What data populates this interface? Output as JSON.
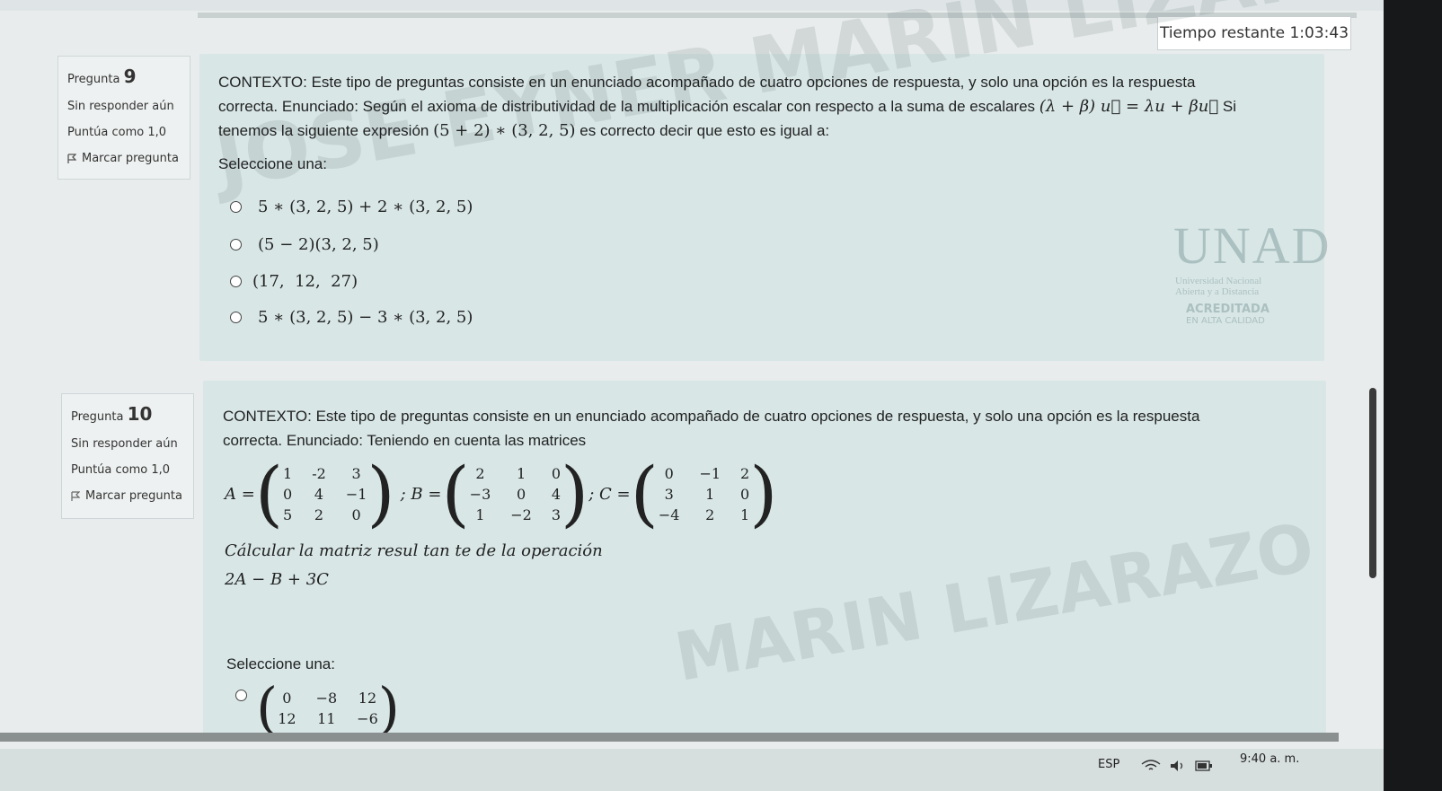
{
  "timer": {
    "label": "Tiempo restante",
    "value": "1:03:43"
  },
  "watermark": {
    "line1": "JOSE EYNER MARIN LIZARAZO",
    "line2": "MARIN LIZARAZO"
  },
  "logo": {
    "name": "UNAD",
    "sub1": "Universidad Nacional",
    "sub2": "Abierta y a Distancia",
    "badge": "ACREDITADA",
    "badge2": "EN ALTA CALIDAD"
  },
  "q9": {
    "label": "Pregunta",
    "number": "9",
    "status": "Sin responder aún",
    "score": "Puntúa como 1,0",
    "flag": "Marcar pregunta",
    "text1": "CONTEXTO: Este tipo de preguntas consiste en un enunciado acompañado de cuatro opciones de respuesta, y solo una opción es la respuesta",
    "text2a": "correcta. Enunciado: Según el axioma de distributividad de la multiplicación escalar con respecto a la suma de escalares",
    "formula1": "(λ + β) u⃗ = λu + βu⃗",
    "text2b": "Si",
    "text3a": "tenemos la siguiente expresión",
    "formula2": "(5 + 2) ∗ (3, 2, 5)",
    "text3b": "es correcto decir que esto es igual a:",
    "prompt": "Seleccione una:",
    "options": [
      "5 ∗ (3, 2, 5) + 2 ∗ (3, 2, 5)",
      "(5 − 2)(3, 2, 5)",
      "(17,  12,  27)",
      "5 ∗ (3, 2, 5) − 3 ∗ (3, 2, 5)"
    ]
  },
  "q10": {
    "label": "Pregunta",
    "number": "10",
    "status": "Sin responder aún",
    "score": "Puntúa como 1,0",
    "flag": "Marcar pregunta",
    "text1": "CONTEXTO: Este tipo de preguntas consiste en un enunciado acompañado de cuatro opciones de respuesta, y solo una opción es la respuesta",
    "text2": "correcta. Enunciado: Teniendo en cuenta las matrices",
    "A": {
      "name": "A =",
      "cells": [
        "1",
        "-2",
        "3",
        "0",
        "4",
        "−1",
        "5",
        "2",
        "0"
      ]
    },
    "B": {
      "name": "; B =",
      "cells": [
        "2",
        "1",
        "0",
        "−3",
        "0",
        "4",
        "1",
        "−2",
        "3"
      ]
    },
    "C": {
      "name": "; C =",
      "cells": [
        "0",
        "−1",
        "2",
        "3",
        "1",
        "0",
        "−4",
        "2",
        "1"
      ]
    },
    "instruction": "Cálcular la matriz resul tan te de la operación",
    "operation": "2A − B + 3C",
    "prompt": "Seleccione una:",
    "option1": {
      "cells": [
        "0",
        "−8",
        "12",
        "12",
        "11",
        "−6"
      ]
    }
  },
  "taskbar": {
    "lang": "ESP",
    "time": "9:40 a. m."
  }
}
